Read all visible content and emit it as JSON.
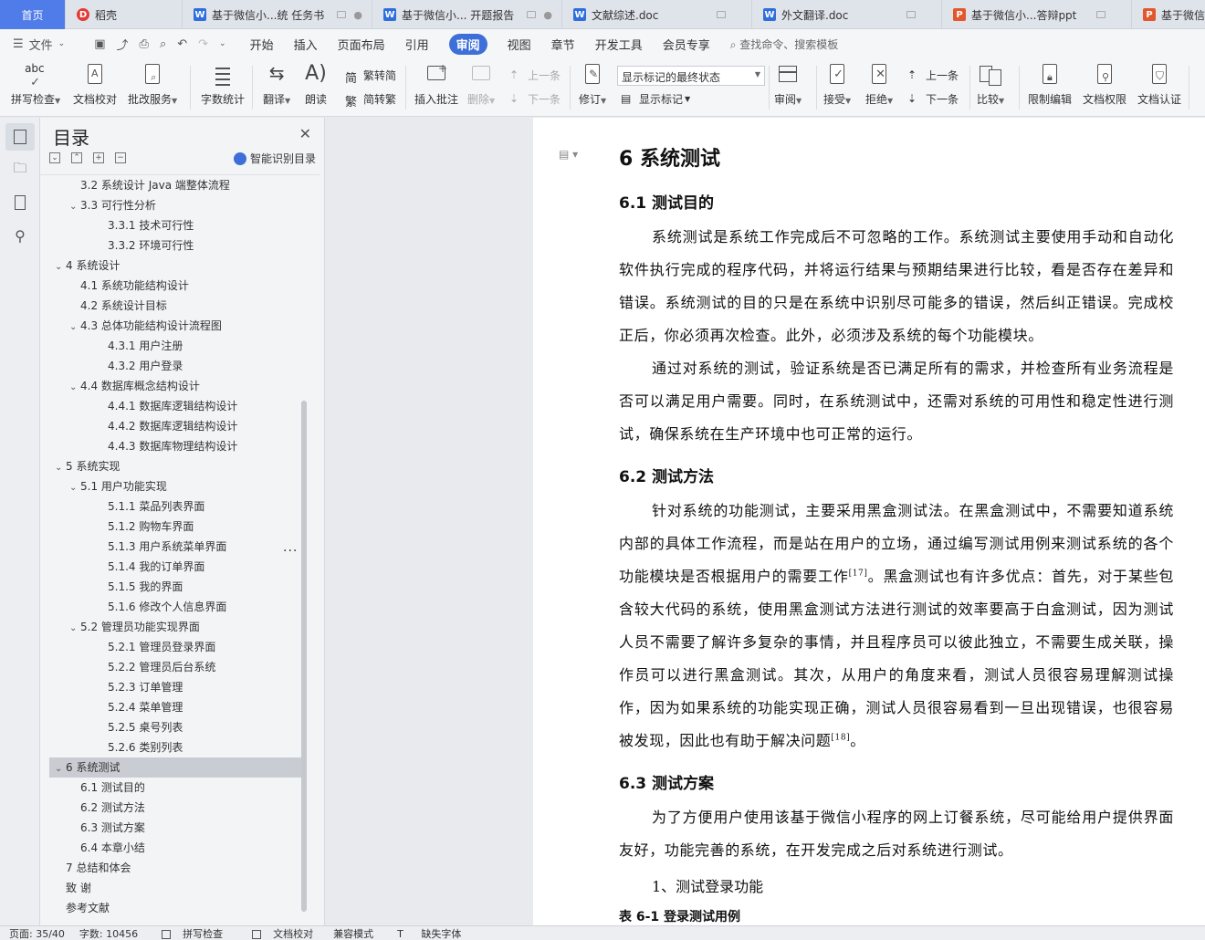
{
  "tabs": [
    {
      "label": "首页",
      "icon": "home-icon"
    },
    {
      "label": "稻壳",
      "icon": "docer-icon"
    },
    {
      "label": "基于微信小...统 任务书",
      "icon": "word-icon"
    },
    {
      "label": "基于微信小... 开题报告",
      "icon": "word-icon"
    },
    {
      "label": "文献综述.doc",
      "icon": "word-icon"
    },
    {
      "label": "外文翻译.doc",
      "icon": "word-icon"
    },
    {
      "label": "基于微信小...答辩ppt",
      "icon": "ppt-icon"
    },
    {
      "label": "基于微信",
      "icon": "ppt-icon"
    }
  ],
  "menu": {
    "file": "文件",
    "items": [
      "开始",
      "插入",
      "页面布局",
      "引用",
      "审阅",
      "视图",
      "章节",
      "开发工具",
      "会员专享"
    ],
    "active": "审阅",
    "search": "查找命令、搜索模板"
  },
  "ribbon": {
    "spell": "拼写检查",
    "proof": "文档校对",
    "batch": "批改服务",
    "wordcount": "字数统计",
    "translate": "翻译",
    "read": "朗读",
    "trad": "繁转简",
    "simp": "简转繁",
    "insert_comment": "插入批注",
    "delete": "删除",
    "prev_comment": "上一条",
    "next_comment": "下一条",
    "revise": "修订",
    "markup_combo": "显示标记的最终状态",
    "show_markup": "显示标记",
    "review": "审阅",
    "accept": "接受",
    "reject": "拒绝",
    "prev_change": "上一条",
    "next_change": "下一条",
    "compare": "比较",
    "restrict": "限制编辑",
    "permission": "文档权限",
    "certify": "文档认证",
    "abc": "abc"
  },
  "toc": {
    "title": "目录",
    "smart": "智能识别目录",
    "items": [
      {
        "text": "3.2 系统设计 Java 端整体流程",
        "level": 2,
        "arrow": ""
      },
      {
        "text": "3.3  可行性分析",
        "level": 2,
        "arrow": "v"
      },
      {
        "text": "3.3.1 技术可行性",
        "level": 3,
        "arrow": ""
      },
      {
        "text": "3.3.2 环境可行性",
        "level": 3,
        "arrow": ""
      },
      {
        "text": "4    系统设计",
        "level": 1,
        "arrow": "v"
      },
      {
        "text": "4.1 系统功能结构设计",
        "level": 2,
        "arrow": ""
      },
      {
        "text": "4.2 系统设计目标",
        "level": 2,
        "arrow": ""
      },
      {
        "text": "4.3 总体功能结构设计流程图",
        "level": 2,
        "arrow": "v"
      },
      {
        "text": "4.3.1 用户注册",
        "level": 3,
        "arrow": ""
      },
      {
        "text": "4.3.2 用户登录",
        "level": 3,
        "arrow": ""
      },
      {
        "text": "4.4 数据库概念结构设计",
        "level": 2,
        "arrow": "v"
      },
      {
        "text": "4.4.1 数据库逻辑结构设计",
        "level": 3,
        "arrow": ""
      },
      {
        "text": "4.4.2  数据库逻辑结构设计",
        "level": 3,
        "arrow": ""
      },
      {
        "text": "4.4.3  数据库物理结构设计",
        "level": 3,
        "arrow": ""
      },
      {
        "text": "5    系统实现",
        "level": 1,
        "arrow": "v"
      },
      {
        "text": "5.1 用户功能实现",
        "level": 2,
        "arrow": "v"
      },
      {
        "text": "5.1.1 菜品列表界面",
        "level": 3,
        "arrow": ""
      },
      {
        "text": "5.1.2 购物车界面",
        "level": 3,
        "arrow": ""
      },
      {
        "text": "5.1.3  用户系统菜单界面",
        "level": 3,
        "arrow": ""
      },
      {
        "text": "5.1.4  我的订单界面",
        "level": 3,
        "arrow": ""
      },
      {
        "text": "5.1.5  我的界面",
        "level": 3,
        "arrow": ""
      },
      {
        "text": "5.1.6  修改个人信息界面",
        "level": 3,
        "arrow": ""
      },
      {
        "text": "5.2 管理员功能实现界面",
        "level": 2,
        "arrow": "v"
      },
      {
        "text": "5.2.1 管理员登录界面",
        "level": 3,
        "arrow": ""
      },
      {
        "text": "5.2.2 管理员后台系统",
        "level": 3,
        "arrow": ""
      },
      {
        "text": "5.2.3  订单管理",
        "level": 3,
        "arrow": ""
      },
      {
        "text": "5.2.4  菜单管理",
        "level": 3,
        "arrow": ""
      },
      {
        "text": "5.2.5  桌号列表",
        "level": 3,
        "arrow": ""
      },
      {
        "text": "5.2.6  类别列表",
        "level": 3,
        "arrow": ""
      },
      {
        "text": "6  系统测试",
        "level": 1,
        "arrow": "v",
        "selected": true
      },
      {
        "text": "6.1 测试目的",
        "level": 2,
        "arrow": ""
      },
      {
        "text": "6.2 测试方法",
        "level": 2,
        "arrow": ""
      },
      {
        "text": "6.3 测试方案",
        "level": 2,
        "arrow": ""
      },
      {
        "text": "6.4 本章小结",
        "level": 2,
        "arrow": ""
      },
      {
        "text": "7    总结和体会",
        "level": 1,
        "arrow": ""
      },
      {
        "text": "致    谢",
        "level": 1,
        "arrow": ""
      },
      {
        "text": "参考文献",
        "level": 1,
        "arrow": ""
      }
    ],
    "more": "..."
  },
  "document": {
    "h1": "6  系统测试",
    "s1_title": "6.1 测试目的",
    "s1_p1": "系统测试是系统工作完成后不可忽略的工作。系统测试主要使用手动和自动化软件执行完成的程序代码，并将运行结果与预期结果进行比较，看是否存在差异和错误。系统测试的目的只是在系统中识别尽可能多的错误，然后纠正错误。完成校正后，你必须再次检查。此外，必须涉及系统的每个功能模块。",
    "s1_p2": "通过对系统的测试，验证系统是否已满足所有的需求，并检查所有业务流程是否可以满足用户需要。同时，在系统测试中，还需对系统的可用性和稳定性进行测试，确保系统在生产环境中也可正常的运行。",
    "s2_title": "6.2 测试方法",
    "s2_p1_a": "针对系统的功能测试，主要采用黑盒测试法。在黑盒测试中，不需要知道系统内部的具体工作流程，而是站在用户的立场，通过编写测试用例来测试系统的各个功能模块是否根据用户的需要工作",
    "s2_p1_ref1": "[17]",
    "s2_p1_b": "。黑盒测试也有许多优点：首先，对于某些包含较大代码的系统，使用黑盒测试方法进行测试的效率要高于白盒测试，因为测试人员不需要了解许多复杂的事情，并且程序员可以彼此独立，不需要生成关联，操作员可以进行黑盒测试。其次，从用户的角度来看，测试人员很容易理解测试操作，因为如果系统的功能实现正确，测试人员很容易看到一旦出现错误，也很容易被发现，因此也有助于解决问题",
    "s2_p1_ref2": "[18]",
    "s2_p1_c": "。",
    "s3_title": "6.3 测试方案",
    "s3_p1": "为了方便用户使用该基于微信小程序的网上订餐系统，尽可能给用户提供界面友好，功能完善的系统，在开发完成之后对系统进行测试。",
    "s3_item1": "1、测试登录功能",
    "table_caption": "表 6-1  登录测试用例"
  },
  "status": {
    "page": "页面: 35/40",
    "words": "字数: 10456",
    "spell": "拼写检查",
    "proof": "文档校对",
    "compat": "兼容模式",
    "missing_font": "缺失字体"
  },
  "colors": {
    "accent": "#3e6fd8",
    "home_tab": "#4f7ce8",
    "word_icon": "#2f6fdd",
    "ppt_icon": "#e2572b",
    "toc_selected": "#c9ccd2"
  }
}
